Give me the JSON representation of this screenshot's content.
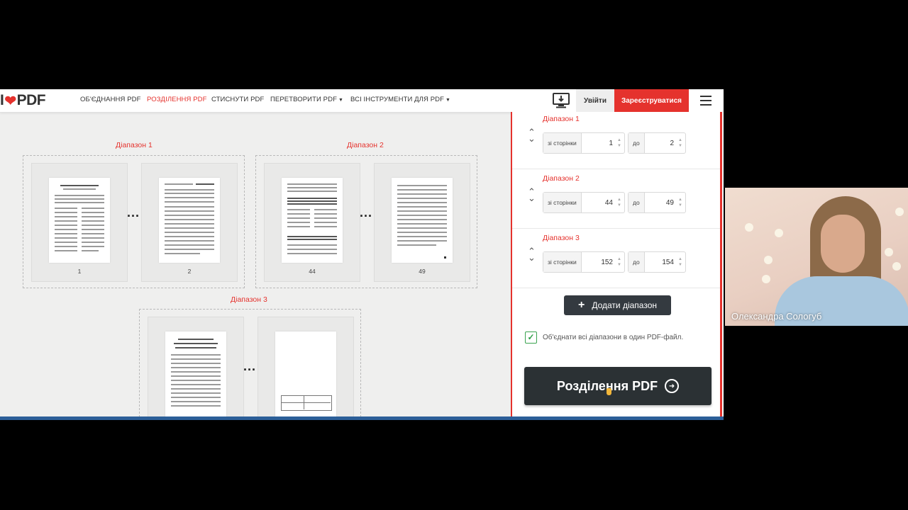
{
  "nav": {
    "logo_left": "I",
    "logo_right": "PDF",
    "links": [
      {
        "label": "ОБ'ЄДНАННЯ PDF",
        "active": false
      },
      {
        "label": "РОЗДІЛЕННЯ PDF",
        "active": true
      },
      {
        "label": "СТИСНУТИ PDF",
        "active": false
      },
      {
        "label": "ПЕРЕТВОРИТИ PDF",
        "active": false,
        "dropdown": true
      },
      {
        "label": "ВСІ ІНСТРУМЕНТИ ДЛЯ PDF",
        "active": false,
        "dropdown": true
      }
    ],
    "login": "Увійти",
    "signup": "Зареєструватися"
  },
  "preview": {
    "groups": [
      {
        "label": "Діапазон 1",
        "pages": [
          "1",
          "2"
        ]
      },
      {
        "label": "Діапазон 2",
        "pages": [
          "44",
          "49"
        ]
      },
      {
        "label": "Діапазон 3",
        "pages": [
          "",
          ""
        ]
      }
    ],
    "ellipsis": "..."
  },
  "sidebar": {
    "ranges": [
      {
        "title": "Діапазон 1",
        "from_label": "зі сторінки",
        "from": "1",
        "to_label": "до",
        "to": "2"
      },
      {
        "title": "Діапазон 2",
        "from_label": "зі сторінки",
        "from": "44",
        "to_label": "до",
        "to": "49"
      },
      {
        "title": "Діапазон 3",
        "from_label": "зі сторінки",
        "from": "152",
        "to_label": "до",
        "to": "154"
      }
    ],
    "add_range": "Додати діапазон",
    "merge_label": "Об'єднати всі діапазони в один PDF-файл.",
    "merge_checked": true,
    "split_button": "Розділення PDF"
  },
  "webcam": {
    "name": "Олександра Сологуб"
  },
  "colors": {
    "brand": "#e5322d",
    "dark_button": "#2b3134",
    "checkbox": "#2e9e47"
  }
}
